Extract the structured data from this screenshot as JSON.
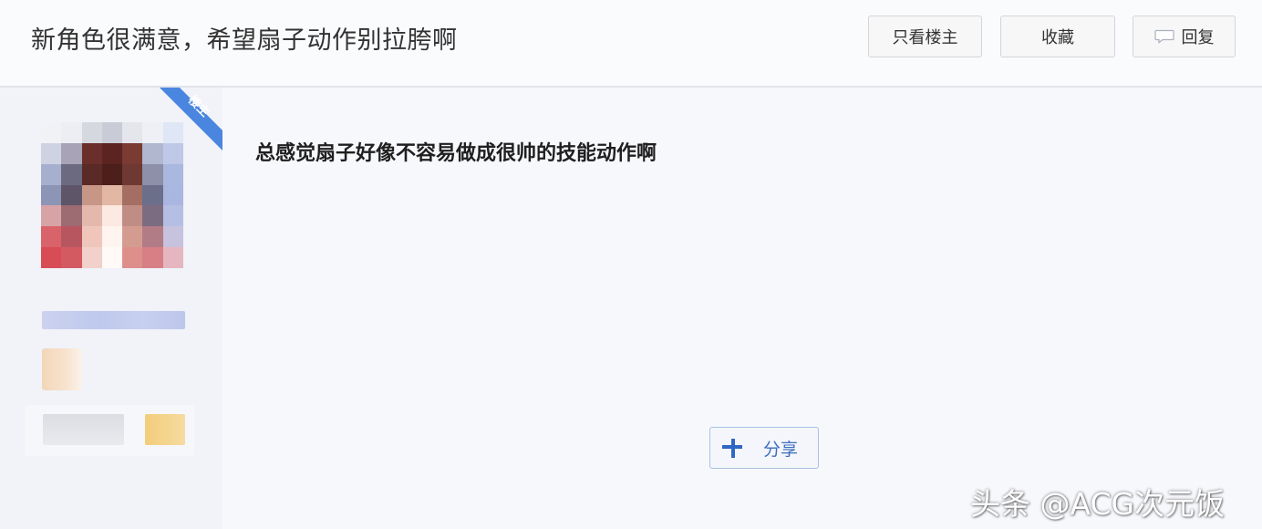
{
  "thread": {
    "title": "新角色很满意，希望扇子动作别拉胯啊"
  },
  "header_buttons": {
    "only_op": "只看楼主",
    "favorite": "收藏",
    "reply": "回复",
    "reply_icon": "comment-bubble-icon"
  },
  "author": {
    "op_badge": "楼主",
    "avatar": "pixelated-avatar"
  },
  "post": {
    "text": "总感觉扇子好像不容易做成很帅的技能动作啊"
  },
  "share": {
    "label": "分享",
    "icon": "plus-share-icon"
  },
  "watermark": {
    "text": "头条 @ACG次元饭"
  },
  "colors": {
    "accent_blue": "#4a86e0",
    "share_blue": "#3d6fbf"
  }
}
